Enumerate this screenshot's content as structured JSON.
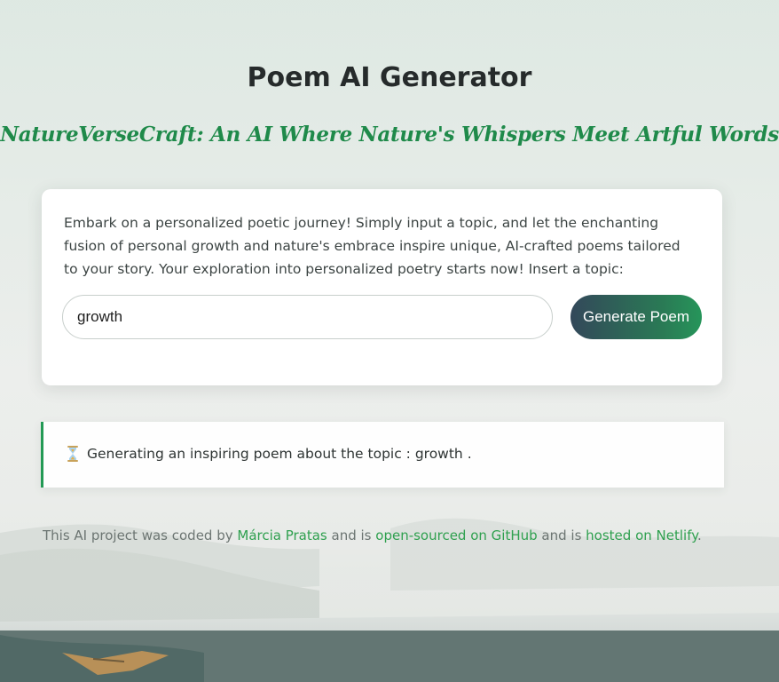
{
  "header": {
    "title": "Poem AI Generator",
    "subtitle": "NatureVerseCraft: An AI Where Nature's Whispers Meet Artful Words"
  },
  "form": {
    "intro": "Embark on a personalized poetic journey! Simply input a topic, and let the enchanting fusion of personal growth and nature's embrace inspire unique, AI-crafted poems tailored to your story. Your exploration into personalized poetry starts now! Insert a topic:",
    "topic_value": "growth",
    "generate_label": "Generate Poem"
  },
  "status": {
    "icon": "hourglass-icon",
    "message": "Generating an inspiring poem about the topic : growth",
    "suffix": "."
  },
  "footer": {
    "part1": "This AI project was coded by ",
    "author_link": "Márcia Pratas",
    "part2": " and is ",
    "github_link": "open-sourced on GitHub",
    "part3": " and is ",
    "netlify_link": "hosted on Netlify",
    "part4": "."
  },
  "colors": {
    "accent_green": "#239a55",
    "title": "#262b2b",
    "button_start": "#33485a",
    "button_end": "#26955a"
  }
}
